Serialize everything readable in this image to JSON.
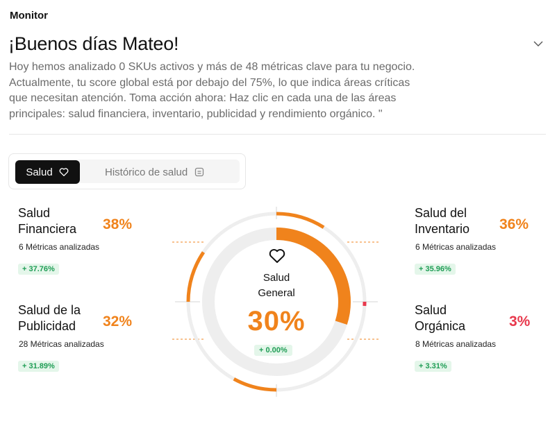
{
  "app": {
    "title": "Monitor"
  },
  "header": {
    "greeting": "¡Buenos días Mateo!",
    "description": "Hoy hemos analizado 0 SKUs activos y más de 48 métricas clave para tu negocio. Actualmente, tu score global está por debajo del 75%, lo que indica áreas críticas que necesitan atención. Toma acción ahora: Haz clic en cada una de las áreas principales: salud financiera, inventario, publicidad y rendimiento orgánico. \""
  },
  "tabs": [
    {
      "label": "Salud",
      "icon": "heart-icon",
      "active": true
    },
    {
      "label": "Histórico de salud",
      "icon": "calendar-icon",
      "active": false
    }
  ],
  "colors": {
    "orange": "#f0831c",
    "red": "#e8394d",
    "green": "#1f9d55",
    "green_bg": "#e4f6ea",
    "ring_bg": "#eeeeee"
  },
  "metrics": {
    "financiera": {
      "title_line1": "Salud",
      "title_line2": "Financiera",
      "pct": "38%",
      "value": 38,
      "count": "6 Métricas analizadas",
      "change": "+ 37.76%",
      "status": "orange"
    },
    "inventario": {
      "title_line1": "Salud del",
      "title_line2": "Inventario",
      "pct": "36%",
      "value": 36,
      "count": "6 Métricas analizadas",
      "change": "+ 35.96%",
      "status": "orange"
    },
    "publicidad": {
      "title_line1": "Salud de la",
      "title_line2": "Publicidad",
      "pct": "32%",
      "value": 32,
      "count": "28 Métricas analizadas",
      "change": "+ 31.89%",
      "status": "orange"
    },
    "organica": {
      "title_line1": "Salud",
      "title_line2": "Orgánica",
      "pct": "3%",
      "value": 3,
      "count": "8 Métricas analizadas",
      "change": "+ 3.31%",
      "status": "red"
    }
  },
  "general": {
    "title_line1": "Salud",
    "title_line2": "General",
    "pct": "30%",
    "value": 30,
    "change": "+ 0.00%"
  }
}
